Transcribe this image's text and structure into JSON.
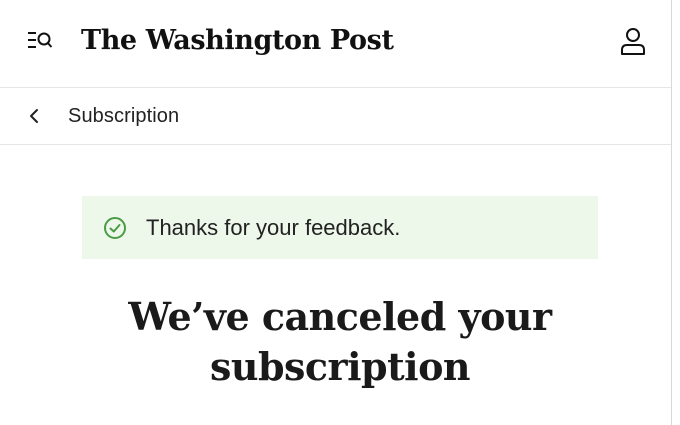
{
  "header": {
    "logo_text": "The Washington Post",
    "menu_icon": "menu-search-icon",
    "account_icon": "user-account-icon"
  },
  "breadcrumb": {
    "back_icon": "chevron-left-icon",
    "label": "Subscription"
  },
  "alert": {
    "icon": "check-circle-icon",
    "message": "Thanks for your feedback.",
    "background": "#edf8ea",
    "icon_color": "#4a9c45"
  },
  "main": {
    "title": "We’ve canceled your subscription"
  }
}
